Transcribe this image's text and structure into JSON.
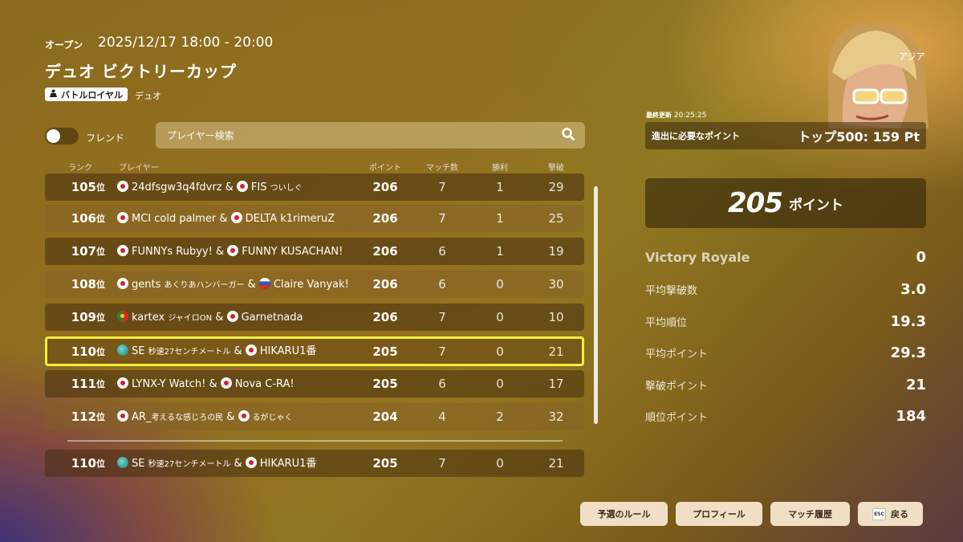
{
  "header": {
    "status": "オープン",
    "datetime": "2025/12/17 18:00 - 20:00",
    "title": "デュオ ビクトリーカップ",
    "mode_badge": "バトルロイヤル",
    "mode_type": "デュオ"
  },
  "filters": {
    "friend_label": "フレンド",
    "friend_toggle_on": false,
    "search_placeholder": "プレイヤー検索"
  },
  "columns": {
    "rank": "ランク",
    "player": "プレイヤー",
    "points": "ポイント",
    "matches": "マッチ数",
    "wins": "勝利",
    "elims": "撃破"
  },
  "rows": [
    {
      "rank": "105",
      "suffix": "位",
      "flag1": "jp",
      "p1": "24dfsgw3q4fdvrz",
      "flag2": "jp",
      "p2": "FIS",
      "p2_small": "ついしぐ",
      "points": "206",
      "matches": "7",
      "wins": "1",
      "elims": "29"
    },
    {
      "rank": "106",
      "suffix": "位",
      "flag1": "jp",
      "p1": "MCI cold palmer",
      "flag2": "jp",
      "p2": "DELTA k1rimeruZ",
      "p2_small": "",
      "points": "206",
      "matches": "7",
      "wins": "1",
      "elims": "25"
    },
    {
      "rank": "107",
      "suffix": "位",
      "flag1": "jp",
      "p1": "FUNNYs Rubyy!",
      "flag2": "jp",
      "p2": "FUNNY KUSACHAN!",
      "p2_small": "",
      "points": "206",
      "matches": "6",
      "wins": "1",
      "elims": "19"
    },
    {
      "rank": "108",
      "suffix": "位",
      "flag1": "jp",
      "p1": "gents",
      "p1_small": "あくりあハンバーガー",
      "flag2": "ru",
      "p2": "Claire Vanyak!",
      "p2_small": "",
      "points": "206",
      "matches": "6",
      "wins": "0",
      "elims": "30"
    },
    {
      "rank": "109",
      "suffix": "位",
      "flag1": "pt",
      "p1": "kartex",
      "p1_small": "ジャイロON",
      "flag2": "jp",
      "p2": "Garnetnada",
      "p2_small": "",
      "points": "206",
      "matches": "7",
      "wins": "0",
      "elims": "10"
    },
    {
      "rank": "110",
      "suffix": "位",
      "flag1": "globe",
      "p1": "SE",
      "p1_small": "秒速27センチメートル",
      "flag2": "jp",
      "p2": "HIKARU1番",
      "p2_small": "",
      "points": "205",
      "matches": "7",
      "wins": "0",
      "elims": "21"
    },
    {
      "rank": "111",
      "suffix": "位",
      "flag1": "jp",
      "p1": "LYNX-Y Watch!",
      "flag2": "jp",
      "p2": "Nova C-RA!",
      "p2_small": "",
      "points": "205",
      "matches": "6",
      "wins": "0",
      "elims": "17"
    },
    {
      "rank": "112",
      "suffix": "位",
      "flag1": "jp",
      "p1": "AR_",
      "p1_small": "考えるな感じろの民",
      "flag2": "jp",
      "p2": "",
      "p2_small": "るがじゃく",
      "points": "204",
      "matches": "4",
      "wins": "2",
      "elims": "32"
    }
  ],
  "own_row": {
    "rank": "110",
    "suffix": "位",
    "flag1": "globe",
    "p1": "SE",
    "p1_small": "秒速27センチメートル",
    "flag2": "jp",
    "p2": "HIKARU1番",
    "points": "205",
    "matches": "7",
    "wins": "0",
    "elims": "21"
  },
  "side": {
    "region": "アジア",
    "updated_label": "最終更新",
    "updated_time": "20:25:25",
    "need_label": "進出に必要なポイント",
    "need_value": "トップ500: 159 Pt",
    "score": "205",
    "score_unit": "ポイント",
    "stats": [
      {
        "label": "Victory Royale",
        "value": "0"
      },
      {
        "label": "平均撃破数",
        "value": "3.0"
      },
      {
        "label": "平均順位",
        "value": "19.3"
      },
      {
        "label": "平均ポイント",
        "value": "29.3"
      },
      {
        "label": "撃破ポイント",
        "value": "21"
      },
      {
        "label": "順位ポイント",
        "value": "184"
      }
    ]
  },
  "buttons": {
    "rules": "予選のルール",
    "profile": "プロフィール",
    "history": "マッチ履歴",
    "esc_key": "ESC",
    "back": "戻る"
  },
  "colors": {
    "highlight_border": "#f3ee3c",
    "button_bg": "#f1dfc5"
  }
}
